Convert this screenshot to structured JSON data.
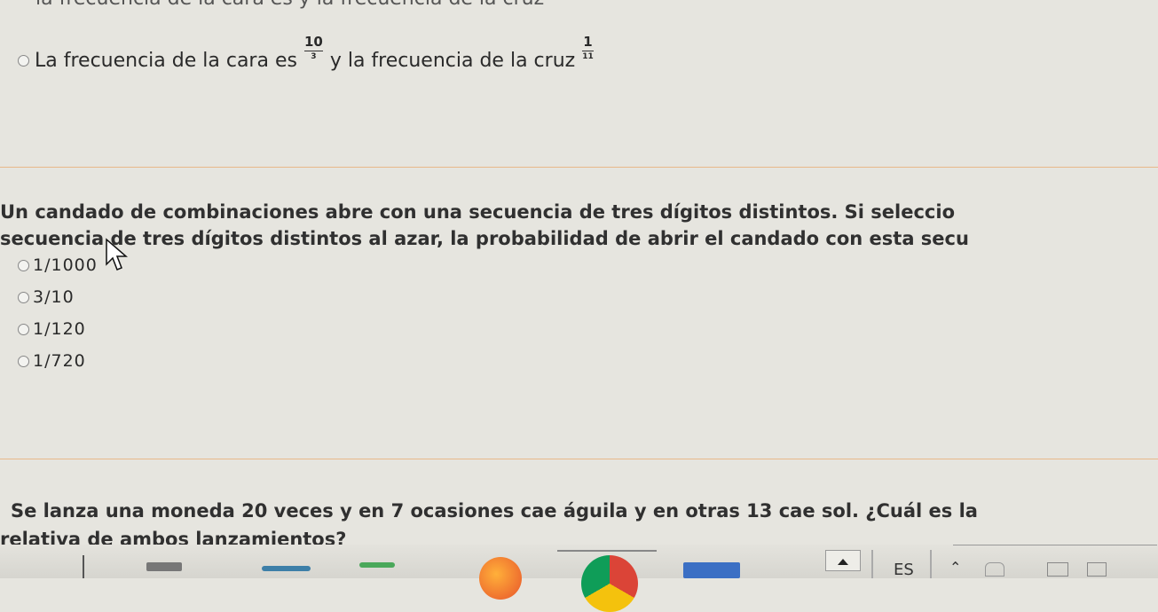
{
  "top_partial_text": "la frecuencia de la cara es     y la frecuencia de la cruz",
  "q1": {
    "text_before": "La frecuencia de la cara es",
    "frac1": {
      "num": "10",
      "den": "3"
    },
    "text_middle": "y la frecuencia de la cruz",
    "frac2": {
      "num": "1",
      "den": "11"
    }
  },
  "q2": {
    "line1": "Un candado de combinaciones abre con una secuencia de tres dígitos distintos. Si seleccio",
    "line2": "secuencia de tres dígitos distintos al azar, la probabilidad de abrir el candado con esta secu",
    "options": [
      "1/1000",
      "3/10",
      "1/120",
      "1/720"
    ]
  },
  "q3": {
    "line1": "Se lanza una moneda 20 veces y en 7 ocasiones cae águila y en otras 13 cae sol. ¿Cuál es la",
    "line2": "relativa de ambos lanzamientos?"
  },
  "taskbar": {
    "language": "ES",
    "icons": [
      "taskbar-app-icon",
      "firefox-icon",
      "chrome-icon",
      "keyboard-icon",
      "up-arrow-icon",
      "chevron-up-icon",
      "network-icon",
      "volume-icon",
      "notification-icon"
    ]
  },
  "colors": {
    "background": "#e6e5df",
    "divider": "#e8b88a",
    "text": "#2a2a2a"
  }
}
